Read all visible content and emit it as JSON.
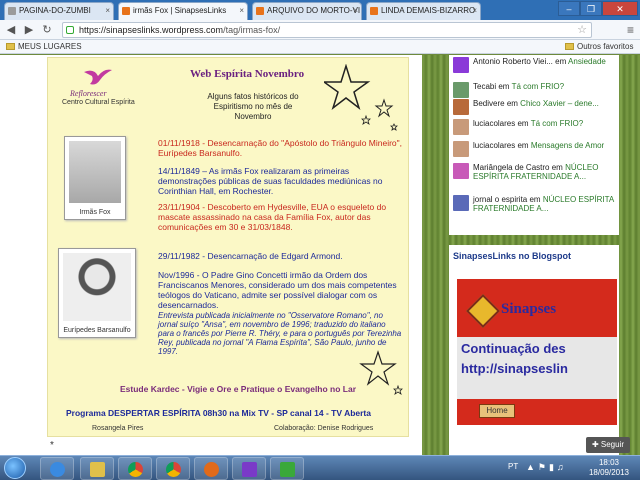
{
  "browser": {
    "tabs": [
      {
        "title": "PAGINA-DO-ZUMBI",
        "active": false
      },
      {
        "title": "irmãs Fox | SinapsesLinks",
        "active": true
      },
      {
        "title": "ARQUIVO DO MORTO-VI",
        "active": false
      },
      {
        "title": "LINDA DEMAIS-BIZARRO",
        "active": false
      }
    ],
    "url_host": "https://sinapseslinks.wordpress.com",
    "url_path": "/tag/irmas-fox/",
    "bookmarks": {
      "folder_left": "MEUS LUGARES",
      "folder_right": "Outros favoritos"
    }
  },
  "poster": {
    "logo_name": "Reflorescer",
    "logo_subtitle": "Centro Cultural Espírita",
    "title": "Web Espírita Novembro",
    "subtitle": "Alguns fatos históricos do Espiritismo no mês de Novembro",
    "photo1_caption": "Irmãs Fox",
    "photo2_caption": "Eurípedes Barsanulfo",
    "events": [
      {
        "text": "01/11/1918 - Desencarnação do \"Apóstolo do Triângulo Mineiro\", Eurípedes Barsanulfo.",
        "color": "red"
      },
      {
        "text": "14/11/1849 – As irmãs Fox realizaram as primeiras demonstrações públicas de suas faculdades mediúnicas no Corinthian Hall, em Rochester.",
        "color": "blue"
      },
      {
        "text": "23/11/1904 - Descoberto em Hydesville, EUA o esqueleto do mascate assassinado na casa da Família Fox, autor das comunicações em 30 e 31/03/1848.",
        "color": "red"
      },
      {
        "text": "29/11/1982 - Desencarnação de Edgard Armond.",
        "color": "blue"
      },
      {
        "text": "Nov/1996 - O Padre Gino Concetti irmão da Ordem dos Franciscanos Menores, considerado um dos mais competentes teólogos do Vaticano, admite ser possível dialogar com os desencarnados.",
        "color": "blue"
      },
      {
        "text": "Entrevista publicada inicialmente no \"Osservatore Romano\", no jornal suíço \"Ansa\", em novembro de 1996; traduzido do italiano para o francês por Pierre R. Théry, e para o português por Terezinha Rey, publicada no jornal \"A Flama Espírita\", São Paulo, junho de 1997.",
        "color": "italic"
      }
    ],
    "motto": "Estude Kardec - Vigie e Ore e  Pratique o Evangelho no Lar",
    "program": "Programa DESPERTAR ESPÍRITA 08h30 na Mix TV - SP canal 14 - TV Aberta",
    "credit_left": "Rosangela Pires",
    "credit_right": "Colaboração: Denise Rodrigues",
    "bullet": "*"
  },
  "sidebar": {
    "comments": [
      {
        "author": "Antonio Roberto Viei...",
        "on": "em",
        "post": "Ansiedade",
        "avatar_color": "#8a3ad8"
      },
      {
        "author": "Tecabi",
        "on": "em",
        "post": "Tá com FRIO?",
        "avatar_color": "#6a9a6a"
      },
      {
        "author": "Bedivere",
        "on": "em",
        "post": "Chico Xavier – dene...",
        "avatar_color": "#b86a3a"
      },
      {
        "author": "luciacolares",
        "on": "em",
        "post": "Tá com FRIO?",
        "avatar_color": "#c89a7a"
      },
      {
        "author": "luciacolares",
        "on": "em",
        "post": "Mensagens de Amor",
        "avatar_color": "#c89a7a"
      },
      {
        "author": "Mariângela de Castro",
        "on": "em",
        "post": "NÚCLEO ESPÍRITA FRATERNIDADE A...",
        "avatar_color": "#c85ab8"
      },
      {
        "author": "jornal o espirita",
        "on": "em",
        "post": "NÚCLEO ESPÍRITA FRATERNIDADE A...",
        "avatar_color": "#5a6ab8"
      }
    ],
    "widget_title": "SinapsesLinks no Blogspot",
    "banner_brand": "Sinapses",
    "banner_line1": "Continuação des",
    "banner_line2": "http://sinapseslin",
    "banner_home": "Home",
    "follow_label": "Seguir"
  },
  "taskbar": {
    "lang": "PT",
    "time": "18:03",
    "date": "18/09/2013"
  },
  "colors": {
    "tab_strip": "#2f6fb5",
    "page_bg": "#6d8a3c",
    "poster_bg": "#fbf8c6",
    "title_purple": "#6a2080",
    "event_red": "#c8281e",
    "event_blue": "#1d2a9a"
  }
}
